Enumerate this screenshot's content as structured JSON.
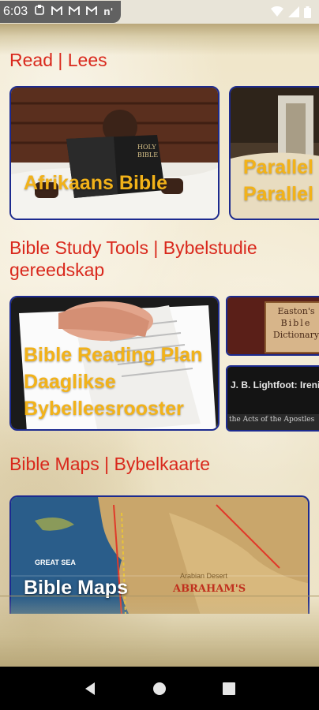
{
  "status_bar": {
    "time": "6:03",
    "notification_icons": [
      "notification-icon",
      "gmail-icon",
      "gmail-icon",
      "gmail-icon"
    ],
    "network_label": "n'"
  },
  "sections": {
    "read": {
      "title": "Read | Lees"
    },
    "study": {
      "title": "Bible Study Tools | Bybelstudie gereedskap"
    },
    "maps": {
      "title": "Bible Maps | Bybelkaarte"
    }
  },
  "cards": {
    "afrikaans_bible": {
      "label": "Afrikaans Bible"
    },
    "parallel": {
      "label_line1": "Parallel",
      "label_line2": "Parallel"
    },
    "reading_plan": {
      "label": "Bible Reading Plan Daaglikse Bybelleesrooster"
    },
    "eastons": {
      "line1": "Easton's",
      "line2": "Bible",
      "line3": "Dictionary"
    },
    "lightfoot": {
      "line1": "J. B. Lightfoot: Irenic",
      "line2": "the Acts of the Apostles"
    },
    "bible_maps": {
      "label": "Bible Maps",
      "map_great_sea": "GREAT SEA",
      "map_arabian": "Arabian Desert",
      "map_abraham": "ABRAHAM'S"
    }
  },
  "colors": {
    "section_title": "#d9281c",
    "card_border": "#1c2a8f",
    "card_label": "#f2b219"
  }
}
